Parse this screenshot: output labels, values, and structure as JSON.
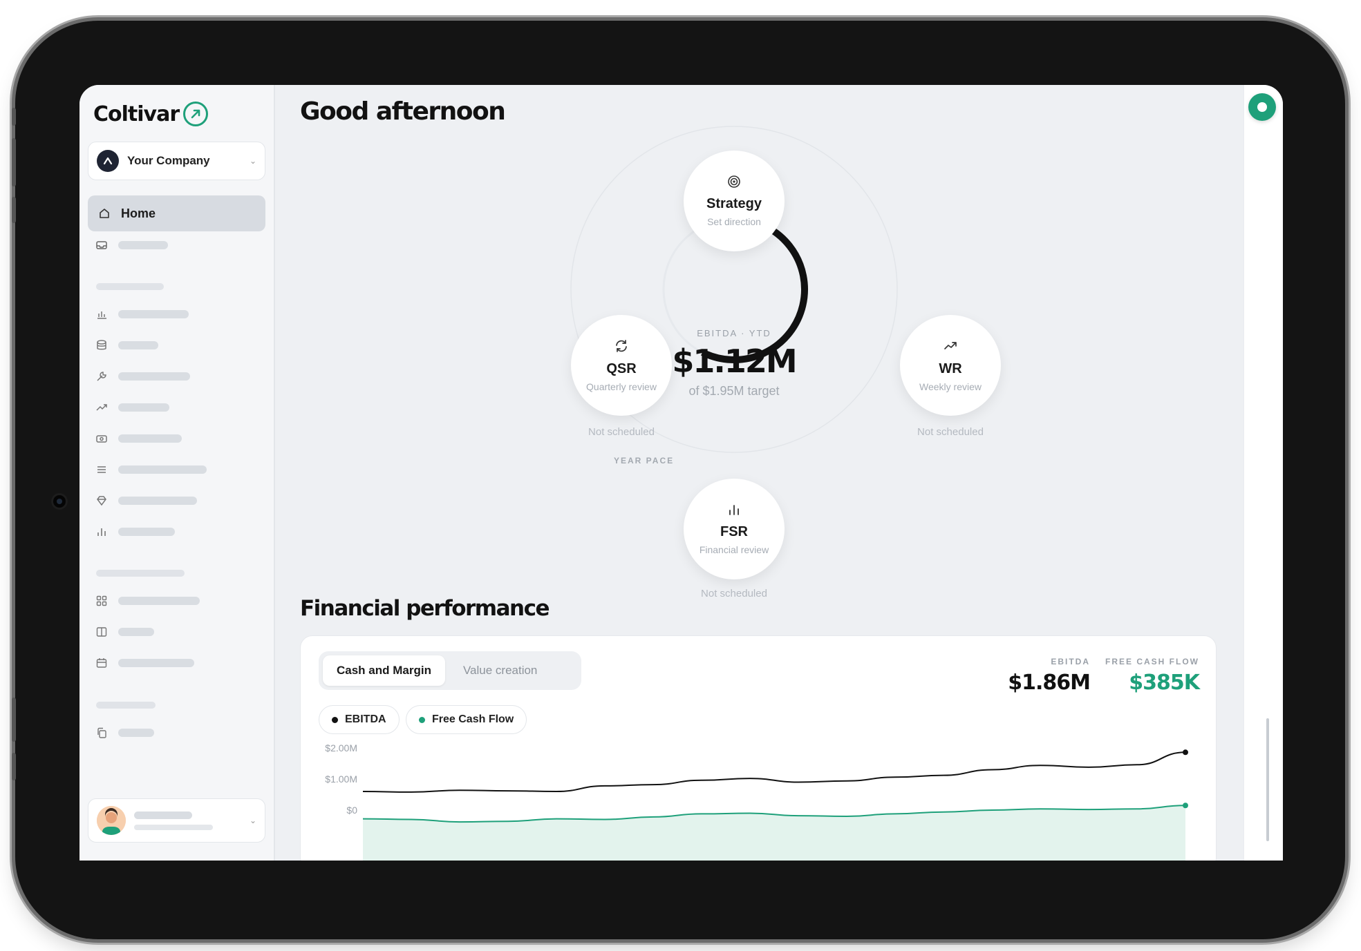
{
  "app": {
    "brand": "Coltivar"
  },
  "sidebar": {
    "company": {
      "name": "Your Company"
    },
    "nav_home_label": "Home"
  },
  "main": {
    "greeting": "Good afternoon",
    "cycle": {
      "center": {
        "eyebrow": "EBITDA · YTD",
        "value": "$1.12M",
        "subtitle": "of $1.95M target",
        "progress": 0.574
      },
      "year_pace_label": "YEAR PACE",
      "nodes": {
        "strategy": {
          "title": "Strategy",
          "subtitle": "Set direction",
          "icon": "target-icon"
        },
        "qsr": {
          "title": "QSR",
          "subtitle": "Quarterly review",
          "status": "Not scheduled",
          "icon": "refresh-icon"
        },
        "wr": {
          "title": "WR",
          "subtitle": "Weekly review",
          "status": "Not scheduled",
          "icon": "trend-up-icon"
        },
        "fsr": {
          "title": "FSR",
          "subtitle": "Financial review",
          "status": "Not scheduled",
          "icon": "bar-chart-icon"
        }
      }
    },
    "financial": {
      "heading": "Financial performance",
      "tabs": [
        {
          "label": "Cash and Margin",
          "active": true
        },
        {
          "label": "Value creation",
          "active": false
        }
      ],
      "stats": {
        "ebitda": {
          "label": "EBITDA",
          "value": "$1.86M",
          "color": "#111111"
        },
        "fcf": {
          "label": "FREE CASH FLOW",
          "value": "$385K",
          "color": "#1ea07a"
        }
      },
      "legend": {
        "ebitda": {
          "label": "EBITDA",
          "color": "#111111"
        },
        "fcf": {
          "label": "Free Cash Flow",
          "color": "#1ea07a"
        }
      }
    }
  },
  "chart_data": {
    "type": "line",
    "title": "",
    "ytick_labels": [
      "$2.00M",
      "$1.00M",
      "$0"
    ],
    "ylim": [
      0,
      2000000
    ],
    "series": [
      {
        "name": "EBITDA",
        "color": "#111111",
        "values": [
          0.6,
          0.58,
          0.64,
          0.62,
          0.6,
          0.78,
          0.82,
          0.96,
          1.02,
          0.9,
          0.94,
          1.06,
          1.12,
          1.3,
          1.44,
          1.38,
          1.46,
          1.86
        ]
      },
      {
        "name": "Free Cash Flow",
        "color": "#1ea07a",
        "values": [
          -0.28,
          -0.3,
          -0.38,
          -0.36,
          -0.28,
          -0.3,
          -0.22,
          -0.12,
          -0.1,
          -0.18,
          -0.2,
          -0.12,
          -0.06,
          0.0,
          0.04,
          0.02,
          0.04,
          0.15
        ]
      }
    ]
  },
  "colors": {
    "accent": "#1ea07a",
    "ring": "#111111",
    "background": "#eef0f3"
  }
}
